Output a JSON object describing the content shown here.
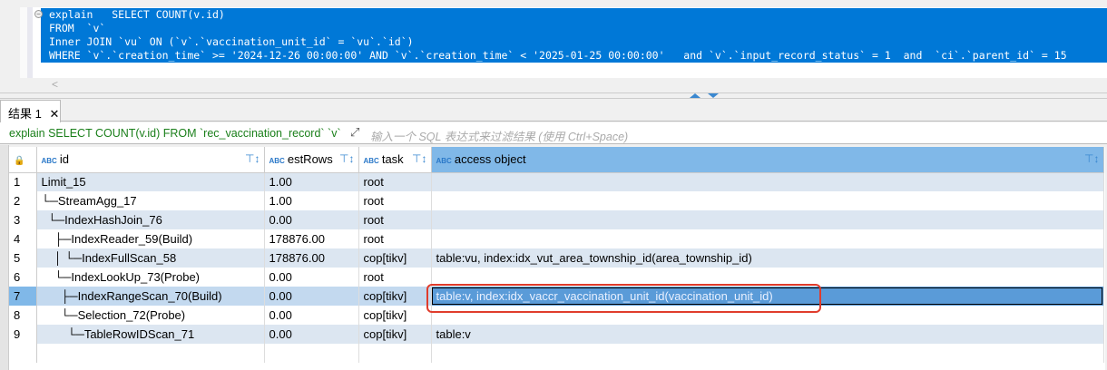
{
  "editor": {
    "lines": [
      "explain   SELECT COUNT(v.id)",
      "FROM  `v`",
      "Inner JOIN `vu` ON (`v`.`vaccination_unit_id` = `vu`.`id`)",
      "WHERE `v`.`creation_time` >= '2024-12-26 00:00:00' AND `v`.`creation_time` < '2025-01-25 00:00:00'   and `v`.`input_record_status` = 1  and  `ci`.`parent_id` = 15"
    ]
  },
  "results": {
    "tab_label": "结果 1",
    "filter_query": "explain SELECT COUNT(v.id) FROM `rec_vaccination_record` `v`",
    "filter_placeholder": "输入一个 SQL 表达式来过滤结果 (使用 Ctrl+Space)"
  },
  "table": {
    "columns": [
      "id",
      "estRows",
      "task",
      "access object"
    ],
    "rows": [
      [
        "1",
        "Limit_15",
        "1.00",
        "root",
        ""
      ],
      [
        "2",
        "└─StreamAgg_17",
        "1.00",
        "root",
        ""
      ],
      [
        "3",
        "  └─IndexHashJoin_76",
        "0.00",
        "root",
        ""
      ],
      [
        "4",
        "    ├─IndexReader_59(Build)",
        "178876.00",
        "root",
        ""
      ],
      [
        "5",
        "    │ └─IndexFullScan_58",
        "178876.00",
        "cop[tikv]",
        "table:vu, index:idx_vut_area_township_id(area_township_id)"
      ],
      [
        "6",
        "    └─IndexLookUp_73(Probe)",
        "0.00",
        "root",
        ""
      ],
      [
        "7",
        "      ├─IndexRangeScan_70(Build)",
        "0.00",
        "cop[tikv]",
        "table:v, index:idx_vaccr_vaccination_unit_id(vaccination_unit_id)"
      ],
      [
        "8",
        "      └─Selection_72(Probe)",
        "0.00",
        "cop[tikv]",
        ""
      ],
      [
        "9",
        "        └─TableRowIDScan_71",
        "0.00",
        "cop[tikv]",
        "table:v"
      ]
    ],
    "selected_row": 7
  }
}
